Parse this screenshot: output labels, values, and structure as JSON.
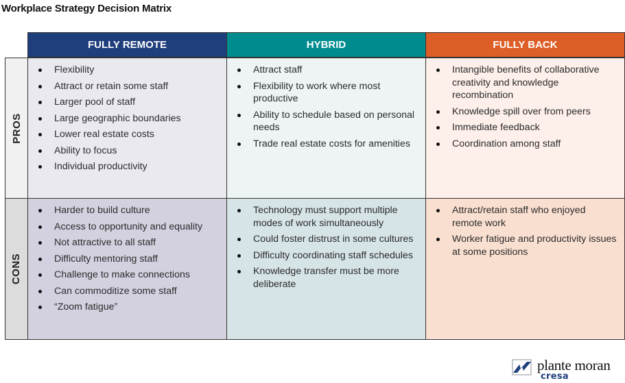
{
  "title": "Workplace Strategy Decision Matrix",
  "columns": [
    {
      "label": "FULLY REMOTE",
      "color": "#1f3e7c"
    },
    {
      "label": "HYBRID",
      "color": "#008c8f"
    },
    {
      "label": "FULLY BACK",
      "color": "#dd5e27"
    }
  ],
  "rows": [
    {
      "label": "PROS"
    },
    {
      "label": "CONS"
    }
  ],
  "cells": {
    "pros": {
      "remote": [
        "Flexibility",
        "Attract or retain some staff",
        "Larger pool of staff",
        "Large geographic boundaries",
        "Lower real estate costs",
        "Ability to focus",
        "Individual productivity"
      ],
      "hybrid": [
        "Attract staff",
        "Flexibility to work where most productive",
        "Ability to schedule based on personal needs",
        "Trade real estate costs for amenities"
      ],
      "back": [
        "Intangible benefits of collaborative creativity and knowledge recombination",
        "Knowledge spill over from peers",
        "Immediate feedback",
        "Coordination among staff"
      ]
    },
    "cons": {
      "remote": [
        "Harder to build culture",
        "Access to opportunity and equality",
        "Not attractive to all staff",
        "Difficulty mentoring staff",
        "Challenge to make connections",
        "Can commoditize some staff",
        "“Zoom fatigue”"
      ],
      "hybrid": [
        "Technology must support multiple modes of work simultaneously",
        "Could foster distrust in some cultures",
        "Difficulty coordinating staff schedules",
        "Knowledge transfer must be more deliberate"
      ],
      "back": [
        "Attract/retain staff who enjoyed remote work",
        "Worker fatigue and productivity issues at some positions"
      ]
    }
  },
  "logo": {
    "name": "plante moran",
    "sub": "cresa",
    "icon": "plante-moran-logo-icon"
  }
}
